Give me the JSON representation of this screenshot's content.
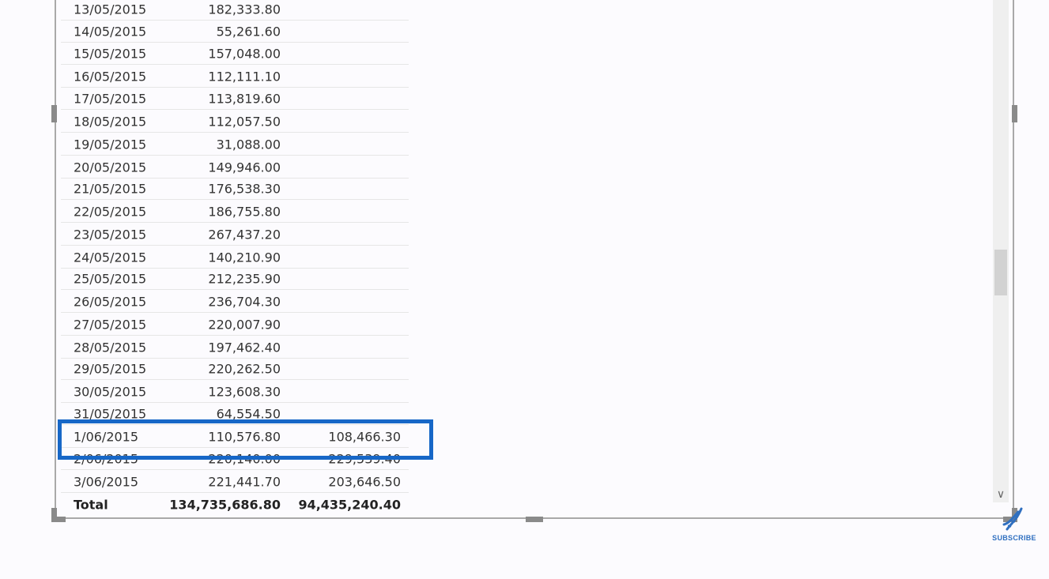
{
  "table": {
    "rows": [
      {
        "date": "13/05/2015",
        "v1": "182,333.80",
        "v2": ""
      },
      {
        "date": "14/05/2015",
        "v1": "55,261.60",
        "v2": ""
      },
      {
        "date": "15/05/2015",
        "v1": "157,048.00",
        "v2": ""
      },
      {
        "date": "16/05/2015",
        "v1": "112,111.10",
        "v2": ""
      },
      {
        "date": "17/05/2015",
        "v1": "113,819.60",
        "v2": ""
      },
      {
        "date": "18/05/2015",
        "v1": "112,057.50",
        "v2": ""
      },
      {
        "date": "19/05/2015",
        "v1": "31,088.00",
        "v2": ""
      },
      {
        "date": "20/05/2015",
        "v1": "149,946.00",
        "v2": ""
      },
      {
        "date": "21/05/2015",
        "v1": "176,538.30",
        "v2": ""
      },
      {
        "date": "22/05/2015",
        "v1": "186,755.80",
        "v2": ""
      },
      {
        "date": "23/05/2015",
        "v1": "267,437.20",
        "v2": ""
      },
      {
        "date": "24/05/2015",
        "v1": "140,210.90",
        "v2": ""
      },
      {
        "date": "25/05/2015",
        "v1": "212,235.90",
        "v2": ""
      },
      {
        "date": "26/05/2015",
        "v1": "236,704.30",
        "v2": ""
      },
      {
        "date": "27/05/2015",
        "v1": "220,007.90",
        "v2": ""
      },
      {
        "date": "28/05/2015",
        "v1": "197,462.40",
        "v2": ""
      },
      {
        "date": "29/05/2015",
        "v1": "220,262.50",
        "v2": ""
      },
      {
        "date": "30/05/2015",
        "v1": "123,608.30",
        "v2": ""
      },
      {
        "date": "31/05/2015",
        "v1": "64,554.50",
        "v2": ""
      },
      {
        "date": "1/06/2015",
        "v1": "110,576.80",
        "v2": "108,466.30"
      },
      {
        "date": "2/06/2015",
        "v1": "220,140.00",
        "v2": "229,539.40"
      },
      {
        "date": "3/06/2015",
        "v1": "221,441.70",
        "v2": "203,646.50"
      }
    ],
    "total": {
      "label": "Total",
      "v1": "134,735,686.80",
      "v2": "94,435,240.40"
    }
  },
  "scrollbar": {
    "down_icon": "chevron-down-icon",
    "down_glyph": "∨"
  },
  "subscribe": {
    "label": "SUBSCRIBE",
    "icon": "dna-icon",
    "color": "#2f6fc0"
  },
  "highlight": {
    "color": "#1767c7"
  }
}
